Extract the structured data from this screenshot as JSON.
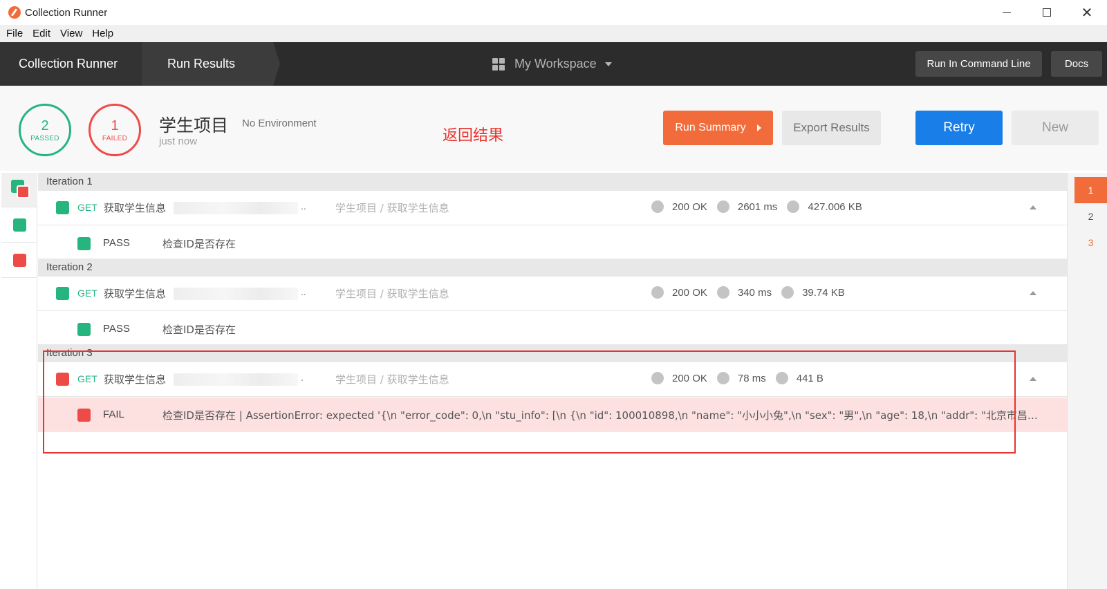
{
  "window": {
    "title": "Collection Runner"
  },
  "menu": [
    "File",
    "Edit",
    "View",
    "Help"
  ],
  "header": {
    "crumb_runner": "Collection Runner",
    "crumb_results": "Run Results",
    "workspace": "My Workspace",
    "btn_command_line": "Run In Command Line",
    "btn_docs": "Docs"
  },
  "summary": {
    "passed_count": "2",
    "passed_label": "PASSED",
    "failed_count": "1",
    "failed_label": "FAILED",
    "collection_name": "学生项目",
    "environment": "No Environment",
    "run_time": "just now",
    "annotation": "返回结果",
    "btn_run_summary": "Run Summary",
    "btn_export": "Export Results",
    "btn_retry": "Retry",
    "btn_new": "New"
  },
  "iterations": [
    {
      "label": "Iteration 1",
      "request": {
        "method": "GET",
        "name": "获取学生信息",
        "url_tail": "..",
        "path": "学生项目 / 获取学生信息",
        "status": "200 OK",
        "time": "2601 ms",
        "size": "427.006 KB"
      },
      "test": {
        "status": "PASS",
        "message": "检查ID是否存在"
      }
    },
    {
      "label": "Iteration 2",
      "request": {
        "method": "GET",
        "name": "获取学生信息",
        "url_tail": "..",
        "path": "学生项目 / 获取学生信息",
        "status": "200 OK",
        "time": "340 ms",
        "size": "39.74 KB"
      },
      "test": {
        "status": "PASS",
        "message": "检查ID是否存在"
      }
    },
    {
      "label": "Iteration 3",
      "request": {
        "method": "GET",
        "name": "获取学生信息",
        "url_tail": ".",
        "path": "学生项目 / 获取学生信息",
        "status": "200 OK",
        "time": "78 ms",
        "size": "441 B"
      },
      "test": {
        "status": "FAIL",
        "message": "检查ID是否存在 | AssertionError: expected '{\\n \"error_code\": 0,\\n \"stu_info\": [\\n {\\n \"id\": 100010898,\\n \"name\": \"小小小兔\",\\n \"sex\": \"男\",\\n \"age\": 18,\\n \"addr\": \"北京市昌平区\",\\n \"gr..."
      }
    }
  ],
  "iteration_nav": [
    "1",
    "2",
    "3"
  ],
  "colors": {
    "pass": "#26b47f",
    "fail": "#ed4b48",
    "accent": "#f26b3a",
    "primary": "#1a7ee8"
  }
}
